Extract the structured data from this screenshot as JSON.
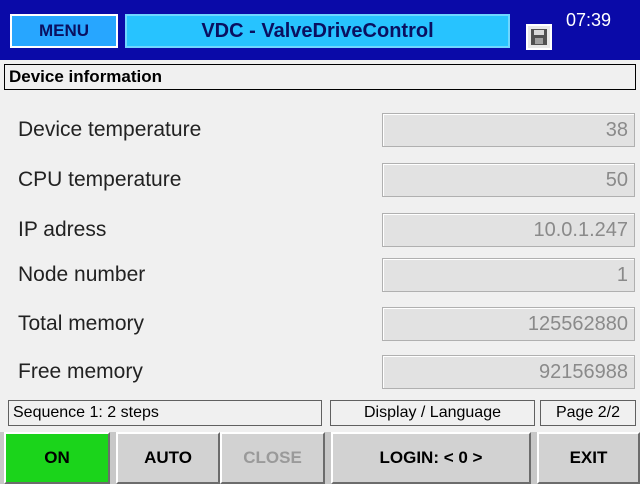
{
  "header": {
    "menu_label": "MENU",
    "title": "VDC - ValveDriveControl",
    "clock": "07:39",
    "save_icon": "floppy-disk-icon"
  },
  "section": {
    "title": "Device information"
  },
  "info": {
    "rows": [
      {
        "label": "Device temperature",
        "value": "38"
      },
      {
        "label": "CPU temperature",
        "value": "50"
      },
      {
        "label": "IP adress",
        "value": "10.0.1.247"
      },
      {
        "label": "Node number",
        "value": "1"
      },
      {
        "label": "Total memory",
        "value": "125562880"
      },
      {
        "label": "Free memory",
        "value": "92156988"
      }
    ]
  },
  "status": {
    "sequence": "Sequence 1: 2 steps",
    "display_language": "Display / Language",
    "page": "Page 2/2"
  },
  "buttons": {
    "on": "ON",
    "auto": "AUTO",
    "close": "CLOSE",
    "login": "LOGIN: < 0 >",
    "exit": "EXIT"
  },
  "colors": {
    "header_bg": "#0a0aa8",
    "title_bg": "#27c3ff",
    "menu_bg": "#27a6ff",
    "on_button": "#1bd41b"
  }
}
